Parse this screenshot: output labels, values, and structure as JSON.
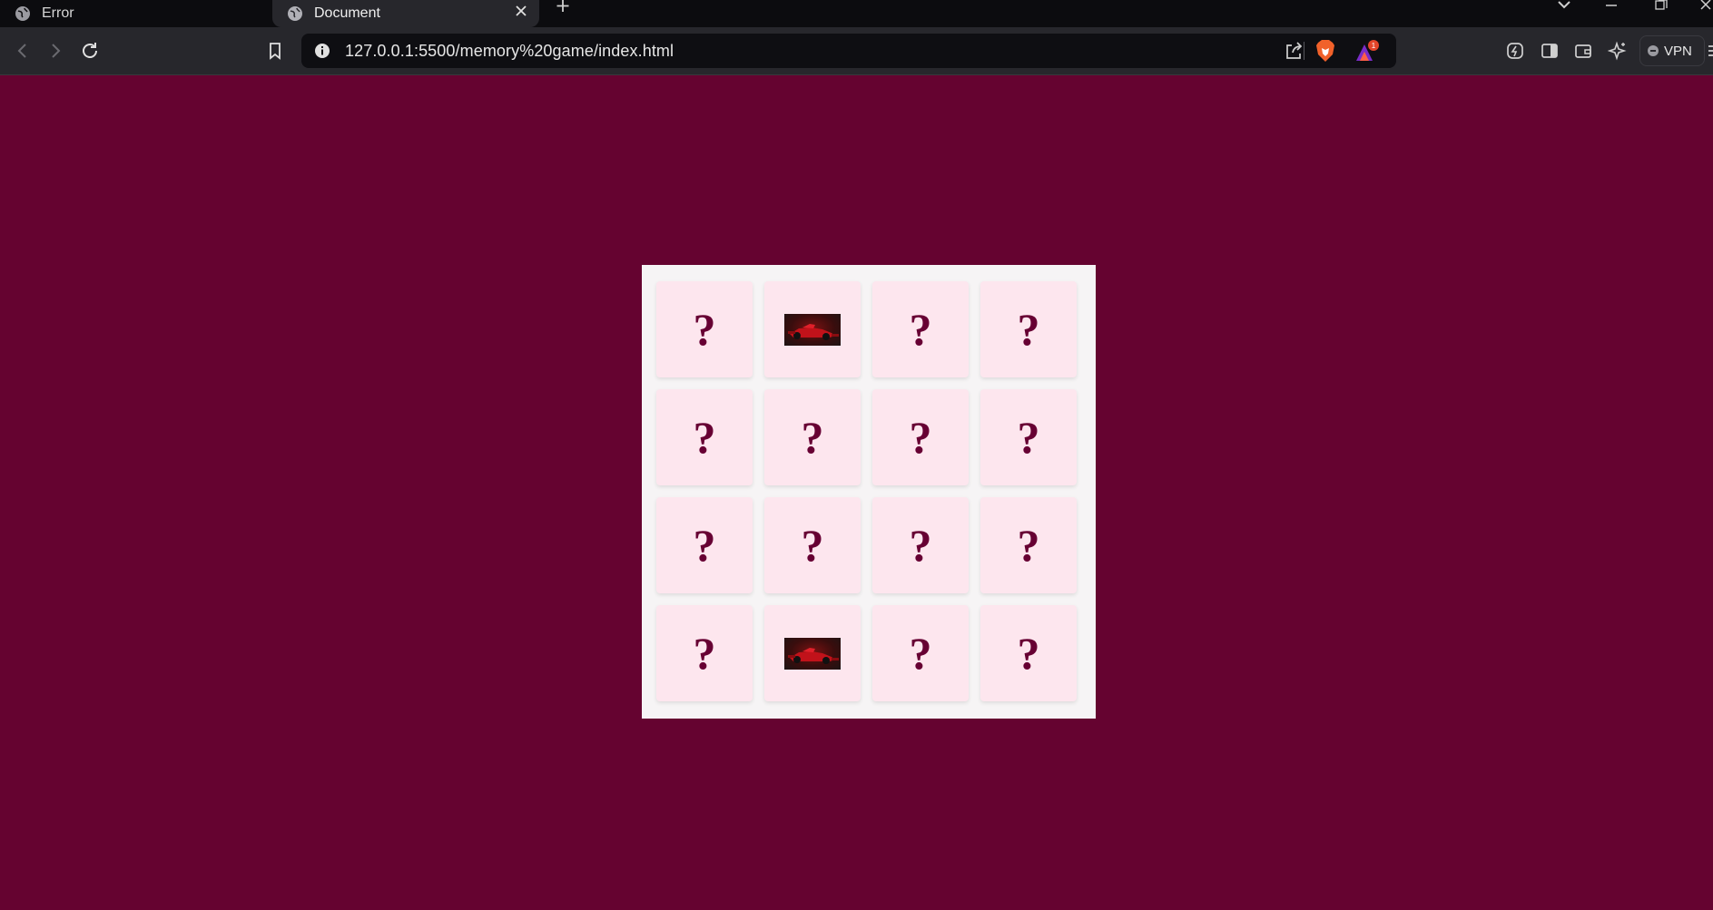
{
  "browser": {
    "tabs": [
      {
        "label": "Error",
        "active": false
      },
      {
        "label": "Document",
        "active": true
      }
    ],
    "address": "127.0.0.1:5500/memory%20game/index.html",
    "rewards_badge": "1",
    "vpn_label": "VPN"
  },
  "colors": {
    "page_background": "#650330",
    "board_background": "#f6f4f5",
    "card_background": "#fde6ee",
    "question_mark": "#670033"
  },
  "game": {
    "columns": 4,
    "rows": 4,
    "hidden_symbol": "?",
    "cards": [
      {
        "state": "hidden"
      },
      {
        "state": "revealed",
        "image": "red-f1-car"
      },
      {
        "state": "hidden"
      },
      {
        "state": "hidden"
      },
      {
        "state": "hidden"
      },
      {
        "state": "hidden"
      },
      {
        "state": "hidden"
      },
      {
        "state": "hidden"
      },
      {
        "state": "hidden"
      },
      {
        "state": "hidden"
      },
      {
        "state": "hidden"
      },
      {
        "state": "hidden"
      },
      {
        "state": "hidden"
      },
      {
        "state": "revealed",
        "image": "red-f1-car"
      },
      {
        "state": "hidden"
      },
      {
        "state": "hidden"
      }
    ]
  }
}
